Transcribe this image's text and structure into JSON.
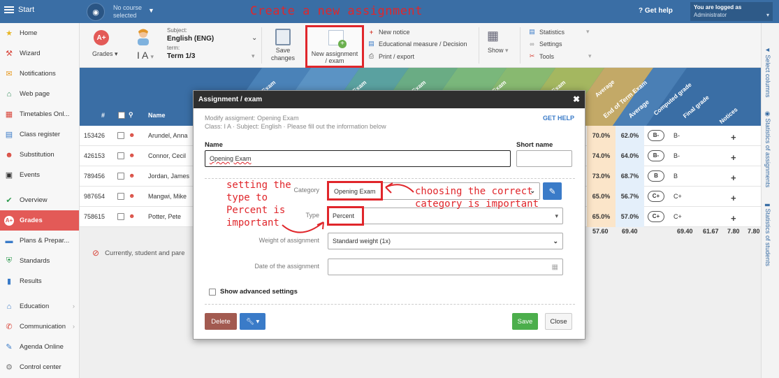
{
  "header": {
    "start_label": "Start",
    "course_line1": "No course",
    "course_line2": "selected",
    "annotation_title": "Create a new assignment",
    "help_label": "Get help",
    "logged_label": "You are logged as",
    "logged_user": "Administrator"
  },
  "sidebar": {
    "items": [
      {
        "label": "Home",
        "icon": "star-icon"
      },
      {
        "label": "Wizard",
        "icon": "wand-icon"
      },
      {
        "label": "Notifications",
        "icon": "envelope-icon"
      },
      {
        "label": "Web page",
        "icon": "house-icon"
      },
      {
        "label": "Timetables Onl...",
        "icon": "timetable-icon"
      },
      {
        "label": "Class register",
        "icon": "book-icon"
      },
      {
        "label": "Substitution",
        "icon": "person-icon"
      },
      {
        "label": "Events",
        "icon": "calendar-icon"
      },
      {
        "label": "Overview",
        "icon": "check-circle-icon"
      },
      {
        "label": "Grades",
        "icon": "grades-icon"
      },
      {
        "label": "Plans & Prepar...",
        "icon": "plans-icon"
      },
      {
        "label": "Standards",
        "icon": "shield-icon"
      },
      {
        "label": "Results",
        "icon": "bar-chart-icon"
      },
      {
        "label": "Education",
        "icon": "education-icon"
      },
      {
        "label": "Communication",
        "icon": "chat-icon"
      },
      {
        "label": "Agenda Online",
        "icon": "pen-icon"
      },
      {
        "label": "Control center",
        "icon": "gear-icon"
      }
    ]
  },
  "toolbar": {
    "grades_label": "Grades",
    "class_label": "I A",
    "subject_caption": "Subject:",
    "subject_value": "English (ENG)",
    "term_caption": "term:",
    "term_value": "Term 1/3",
    "save_line1": "Save",
    "save_line2": "changes",
    "new_assignment_line1": "New assignment",
    "new_assignment_line2": "/ exam",
    "new_notice": "New notice",
    "educational_measure": "Educational measure / Decision",
    "print_export": "Print / export",
    "show_label": "Show",
    "statistics": "Statistics",
    "settings": "Settings",
    "tools": "Tools"
  },
  "table": {
    "col_hash": "#",
    "col_name": "Name",
    "diagonal_labels": [
      "Exam",
      "Exam",
      "Exam",
      "Exam",
      "Exam",
      "Exam"
    ],
    "rot_headers": [
      "Average",
      "End of Term Exam",
      "Average",
      "Computed grade",
      "Final grade",
      "Notices"
    ],
    "rows": [
      {
        "id": "153426",
        "name": "Arundel, Anna",
        "avg1": "70.0%",
        "avg2": "62.0%",
        "computed": "B-",
        "final": "B-"
      },
      {
        "id": "426153",
        "name": "Connor, Cecil",
        "avg1": "74.0%",
        "avg2": "64.0%",
        "computed": "B-",
        "final": "B-"
      },
      {
        "id": "789456",
        "name": "Jordan, James",
        "avg1": "73.0%",
        "avg2": "68.7%",
        "computed": "B",
        "final": "B"
      },
      {
        "id": "987654",
        "name": "Mangwi, Mike",
        "avg1": "65.0%",
        "avg2": "56.7%",
        "computed": "C+",
        "final": "C+"
      },
      {
        "id": "758615",
        "name": "Potter, Pete",
        "avg1": "65.0%",
        "avg2": "57.0%",
        "computed": "C+",
        "final": "C+"
      }
    ],
    "summary": [
      "57.60",
      "69.40",
      "69.40",
      "61.67",
      "7.80",
      "7.80"
    ],
    "notice_text": "Currently, student and pare"
  },
  "rightbar": {
    "tab1": "Select columns",
    "tab2": "Statistics of assignments",
    "tab3": "Statistics of students"
  },
  "modal": {
    "title": "Assignment / exam",
    "subtitle1": "Modify assigment: Opening Exam",
    "subtitle2": "Class: I A · Subject: English · Please fill out the information below",
    "get_help": "GET HELP",
    "name_label": "Name",
    "name_value": "Opening Exam",
    "short_name_label": "Short name",
    "category_label": "Category",
    "category_value": "Opening Exam",
    "type_label": "Type",
    "type_value": "Percent",
    "weight_label": "Weight of assignment",
    "weight_value": "Standard weight (1x)",
    "date_label": "Date of the assignment",
    "advanced_label": "Show advanced settings",
    "delete_label": "Delete",
    "save_label": "Save",
    "close_label": "Close"
  },
  "annotations": {
    "type_note_1": "setting the",
    "type_note_2": "type to",
    "type_note_3": "Percent is",
    "type_note_4": "important",
    "category_note_1": "choosing the correct",
    "category_note_2": "category is important"
  }
}
